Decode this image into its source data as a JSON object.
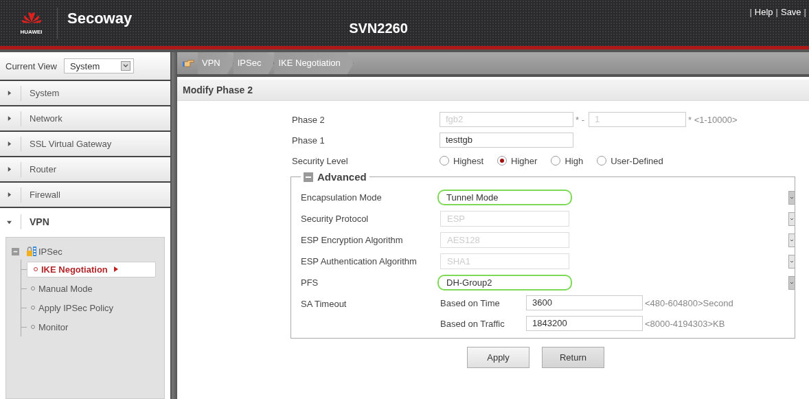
{
  "header": {
    "brand": "HUAWEI",
    "product": "Secoway",
    "model": "SVN2260",
    "links": [
      {
        "kind": "sep",
        "text": "|"
      },
      {
        "kind": "link",
        "text": "Help"
      },
      {
        "kind": "sep",
        "text": "|"
      },
      {
        "kind": "link",
        "text": "Save"
      },
      {
        "kind": "sep",
        "text": "|"
      }
    ]
  },
  "sidebar": {
    "current_view": {
      "label": "Current View",
      "value": "System"
    },
    "menu": [
      {
        "label": "System",
        "expanded": false
      },
      {
        "label": "Network",
        "expanded": false
      },
      {
        "label": "SSL Virtual Gateway",
        "expanded": false
      },
      {
        "label": "Router",
        "expanded": false
      },
      {
        "label": "Firewall",
        "expanded": false
      },
      {
        "label": "VPN",
        "expanded": true
      }
    ],
    "tree": {
      "label": "IPSec",
      "expanded": true,
      "children": [
        {
          "label": "IKE Negotiation",
          "selected": true
        },
        {
          "label": "Manual Mode",
          "selected": false
        },
        {
          "label": "Apply IPSec Policy",
          "selected": false
        },
        {
          "label": "Monitor",
          "selected": false
        }
      ]
    }
  },
  "breadcrumb": [
    "VPN",
    "IPSec",
    "IKE Negotiation"
  ],
  "panel_title": "Modify Phase 2",
  "form": [
    {
      "kind": "dual",
      "label": "Phase 2",
      "disabled": true,
      "inputs": [
        {
          "value": "fgb2",
          "suffix": "* -"
        },
        {
          "value": "1",
          "suffix": "* <1-10000>"
        }
      ]
    },
    {
      "kind": "text",
      "label": "Phase 1",
      "value": "testtgb"
    },
    {
      "kind": "radio",
      "label": "Security Level",
      "options": [
        {
          "label": "Highest",
          "selected": false
        },
        {
          "label": "Higher",
          "selected": true
        },
        {
          "label": "High",
          "selected": false
        },
        {
          "label": "User-Defined",
          "selected": false
        }
      ]
    }
  ],
  "advanced": {
    "title": "Advanced",
    "expanded": true,
    "rows": [
      {
        "kind": "select",
        "label": "Encapsulation Mode",
        "value": "Tunnel Mode",
        "disabled": false,
        "highlighted": true
      },
      {
        "kind": "select",
        "label": "Security Protocol",
        "value": "ESP",
        "disabled": true,
        "highlighted": false
      },
      {
        "kind": "select",
        "label": "ESP Encryption Algorithm",
        "value": "AES128",
        "disabled": true,
        "highlighted": false
      },
      {
        "kind": "select",
        "label": "ESP Authentication Algorithm",
        "value": "SHA1",
        "disabled": true,
        "highlighted": false
      },
      {
        "kind": "select",
        "label": "PFS",
        "value": "DH-Group2",
        "disabled": false,
        "highlighted": true
      },
      {
        "kind": "timeout",
        "label": "SA Timeout",
        "items": [
          {
            "label": "Based on Time",
            "value": "3600",
            "hint": "<480-604800>Second"
          },
          {
            "label": "Based on Traffic",
            "value": "1843200",
            "hint": "<8000-4194303>KB"
          }
        ]
      }
    ]
  },
  "buttons": [
    "Apply",
    "Return"
  ]
}
